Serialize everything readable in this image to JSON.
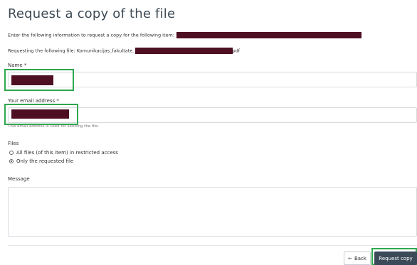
{
  "page": {
    "title": "Request a copy of the file",
    "intro_text": "Enter the following information to request a copy for the following item:",
    "requesting_prefix": "Requesting the following file: Komunikacijas_fakultate_",
    "requesting_suffix": "pdf"
  },
  "form": {
    "name_label": "Name *",
    "email_label": "Your email address *",
    "email_help": "This email address is used for sending the file.",
    "files_label": "Files",
    "files_options": [
      {
        "label": "All files (of this item) in restricted access",
        "selected": false
      },
      {
        "label": "Only the requested file",
        "selected": true
      }
    ],
    "message_label": "Message"
  },
  "actions": {
    "back_label": "Back",
    "request_label": "Request copy"
  },
  "colors": {
    "redaction": "#4e0f23",
    "highlight": "#2fa84f",
    "primary_button": "#3b4a58"
  },
  "icons": {
    "back": "arrow-left-icon"
  }
}
